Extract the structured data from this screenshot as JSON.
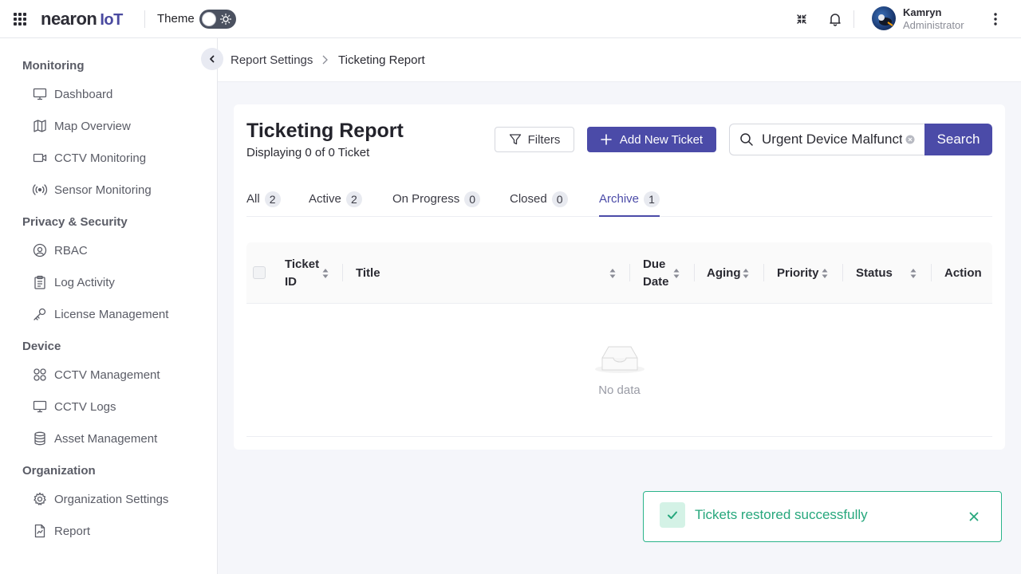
{
  "app": {
    "logo_main": "nearon",
    "logo_sub": "IoT",
    "theme_label": "Theme"
  },
  "user": {
    "name": "Kamryn",
    "role": "Administrator"
  },
  "sidebar": {
    "sections": [
      {
        "title": "Monitoring",
        "items": [
          {
            "label": "Dashboard",
            "icon": "monitor-icon"
          },
          {
            "label": "Map Overview",
            "icon": "map-icon"
          },
          {
            "label": "CCTV Monitoring",
            "icon": "video-camera-icon"
          },
          {
            "label": "Sensor Monitoring",
            "icon": "signal-icon"
          }
        ]
      },
      {
        "title": "Privacy & Security",
        "items": [
          {
            "label": "RBAC",
            "icon": "user-circle-icon"
          },
          {
            "label": "Log Activity",
            "icon": "clipboard-icon"
          },
          {
            "label": "License Management",
            "icon": "key-icon"
          }
        ]
      },
      {
        "title": "Device",
        "items": [
          {
            "label": "CCTV Management",
            "icon": "grid-circles-icon"
          },
          {
            "label": "CCTV Logs",
            "icon": "monitor-icon"
          },
          {
            "label": "Asset Management",
            "icon": "database-icon"
          }
        ]
      },
      {
        "title": "Organization",
        "items": [
          {
            "label": "Organization Settings",
            "icon": "gear-icon"
          },
          {
            "label": "Report",
            "icon": "report-icon"
          }
        ]
      }
    ]
  },
  "breadcrumb": {
    "parent": "Report Settings",
    "current": "Ticketing Report"
  },
  "page": {
    "title": "Ticketing Report",
    "subtitle": "Displaying 0 of 0 Ticket",
    "filters_label": "Filters",
    "add_label": "Add New Ticket",
    "search_value": "Urgent Device Malfunction",
    "search_button": "Search"
  },
  "tabs": [
    {
      "label": "All",
      "count": "2",
      "active": false
    },
    {
      "label": "Active",
      "count": "2",
      "active": false
    },
    {
      "label": "On Progress",
      "count": "0",
      "active": false
    },
    {
      "label": "Closed",
      "count": "0",
      "active": false
    },
    {
      "label": "Archive",
      "count": "1",
      "active": true
    }
  ],
  "table": {
    "columns": [
      "Ticket ID",
      "Title",
      "Due Date",
      "Aging",
      "Priority",
      "Status",
      "Action"
    ],
    "empty_text": "No data"
  },
  "toast": {
    "message": "Tickets restored successfully"
  },
  "colors": {
    "accent": "#4b4ba8",
    "success": "#26a77c"
  }
}
